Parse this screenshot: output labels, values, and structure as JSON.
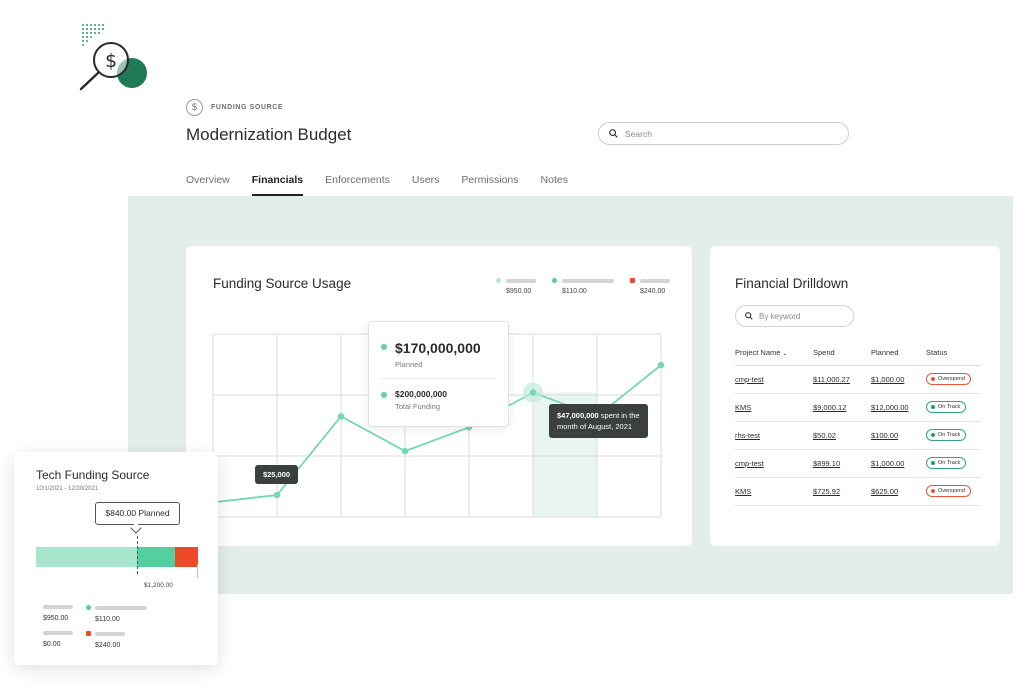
{
  "header": {
    "badge_label": "FUNDING SOURCE",
    "title": "Modernization Budget",
    "search_placeholder": "Search"
  },
  "tabs": [
    {
      "label": "Overview",
      "active": false
    },
    {
      "label": "Financials",
      "active": true
    },
    {
      "label": "Enforcements",
      "active": false
    },
    {
      "label": "Users",
      "active": false
    },
    {
      "label": "Permissions",
      "active": false
    },
    {
      "label": "Notes",
      "active": false
    }
  ],
  "usage": {
    "title": "Funding Source Usage",
    "legend": [
      {
        "value": "$950.00",
        "color": "#b5e8d6"
      },
      {
        "value": "$110.00",
        "color": "#56cf9f"
      },
      {
        "value": "$240.00",
        "color": "#ec4b29"
      }
    ],
    "tooltip": {
      "planned_value": "$170,000,000",
      "planned_label": "Planned",
      "total_value": "$200,000,000",
      "total_label": "Total Funding"
    },
    "callout_august": {
      "amount": "$47,000,000",
      "text": " spent in the month of August, 2021"
    },
    "callout_start": "$25,000"
  },
  "chart_data": {
    "type": "line",
    "series": [
      {
        "values": [
          0.08,
          0.12,
          0.55,
          0.36,
          0.49,
          0.68,
          0.55,
          0.83
        ]
      }
    ],
    "highlight_index": 5,
    "grid": true,
    "ylim": [
      0,
      1
    ]
  },
  "drilldown": {
    "title": "Financial Drilldown",
    "search_placeholder": "By keyword",
    "columns": [
      "Project Name",
      "Spend",
      "Planned",
      "Status"
    ],
    "rows": [
      {
        "name": "cmp-test",
        "spend": "$11,000.27",
        "planned": "$1,000.00",
        "status": "Overspend"
      },
      {
        "name": "KMS",
        "spend": "$9,000.12",
        "planned": "$12,000.00",
        "status": "On Track"
      },
      {
        "name": "rhs-test",
        "spend": "$50.02",
        "planned": "$100.00",
        "status": "On Track"
      },
      {
        "name": "cmp-test",
        "spend": "$899.10",
        "planned": "$1,000.00",
        "status": "On Track"
      },
      {
        "name": "KMS",
        "spend": "$725.92",
        "planned": "$625.00",
        "status": "Overspend"
      }
    ]
  },
  "tech": {
    "title": "Tech Funding Source",
    "dates": "10/1/2021 - 12/30/2021",
    "planned_label": "$840.00 Planned",
    "max_label": "$1,200.00",
    "bar_fractions": {
      "base": 0.61,
      "planned": 0.23,
      "over": 0.14
    },
    "legend": [
      {
        "value": "$950.00"
      },
      {
        "value": "$110.00",
        "color": "#56cf9f"
      },
      {
        "value": "$0.00"
      },
      {
        "value": "$240.00",
        "color": "#ec4b29"
      }
    ]
  },
  "colors": {
    "accent": "#56cf9f",
    "line": "#72d8b3",
    "alert": "#ec4b29",
    "panel": "#e3eeeb"
  }
}
